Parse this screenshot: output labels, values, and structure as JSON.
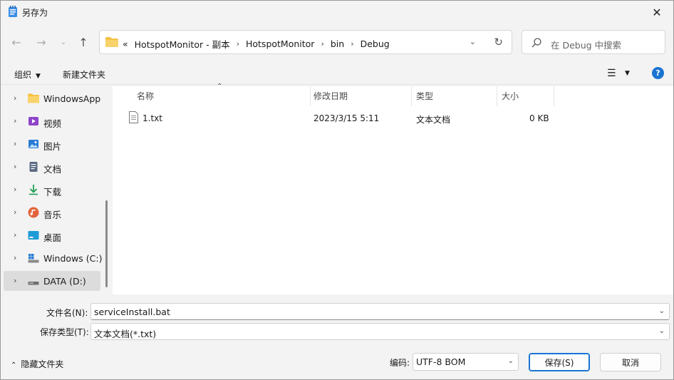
{
  "window": {
    "title": "另存为"
  },
  "nav": {
    "breadcrumb": [
      "HotspotMonitor - 副本",
      "HotspotMonitor",
      "bin",
      "Debug"
    ],
    "overflow": "«",
    "search_placeholder": "在 Debug 中搜索"
  },
  "commands": {
    "organize": "组织",
    "new_folder": "新建文件夹"
  },
  "sidebar": {
    "items": [
      {
        "label": "WindowsApp",
        "icon": "folder-icon"
      },
      {
        "label": "视频",
        "icon": "video-icon"
      },
      {
        "label": "图片",
        "icon": "pictures-icon"
      },
      {
        "label": "文档",
        "icon": "documents-icon"
      },
      {
        "label": "下载",
        "icon": "download-icon"
      },
      {
        "label": "音乐",
        "icon": "music-icon"
      },
      {
        "label": "桌面",
        "icon": "desktop-icon"
      },
      {
        "label": "Windows (C:)",
        "icon": "windows-drive-icon"
      },
      {
        "label": "DATA (D:)",
        "icon": "drive-icon"
      }
    ]
  },
  "filelist": {
    "columns": {
      "name": "名称",
      "date": "修改日期",
      "type": "类型",
      "size": "大小"
    },
    "rows": [
      {
        "name": "1.txt",
        "date": "2023/3/15 5:11",
        "type": "文本文档",
        "size": "0 KB"
      }
    ]
  },
  "form": {
    "filename_label": "文件名(N):",
    "filename_value": "serviceInstall.bat",
    "filetype_label": "保存类型(T):",
    "filetype_value": "文本文档(*.txt)",
    "encoding_label": "编码:",
    "encoding_value": "UTF-8 BOM"
  },
  "footer": {
    "hide_folders": "隐藏文件夹",
    "save": "保存(S)",
    "cancel": "取消"
  },
  "colors": {
    "accent": "#1a74d2",
    "selected": "#dcdcdc",
    "folder": "#f5c242"
  }
}
